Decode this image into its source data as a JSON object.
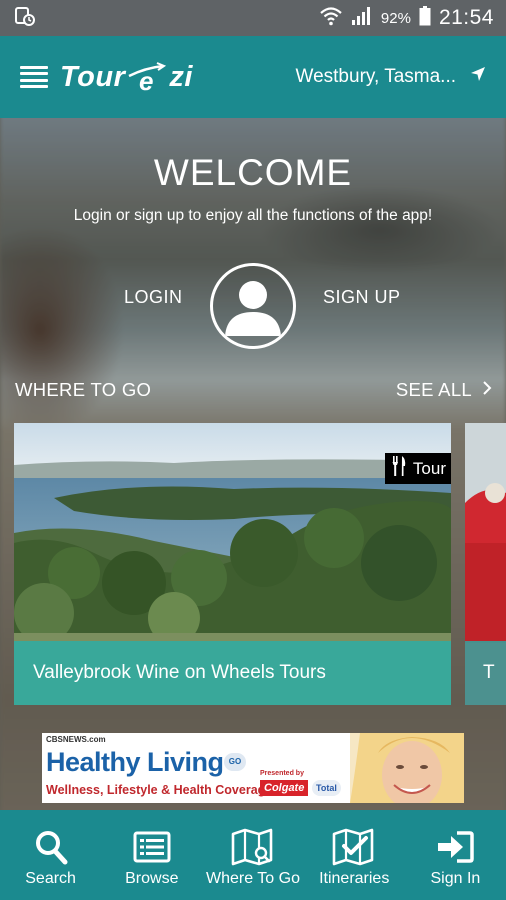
{
  "status_bar": {
    "battery": "92%",
    "time": "21:54",
    "icons": [
      "screenshot-icon",
      "wifi-icon",
      "signal-icon",
      "battery-icon"
    ]
  },
  "header": {
    "logo_left": "Tour",
    "logo_right": "zi",
    "location": "Westbury, Tasma...",
    "icons": [
      "menu-icon",
      "location-arrow-icon"
    ]
  },
  "welcome": {
    "title": "WELCOME",
    "subtitle": "Login or sign up to enjoy all the functions of the app!",
    "login": "LOGIN",
    "signup": "SIGN UP"
  },
  "where_to_go": {
    "title": "WHERE TO GO",
    "see_all": "SEE ALL",
    "cards": [
      {
        "title": "Valleybrook Wine on Wheels Tours",
        "badge": "Tour",
        "badge_icon": "cutlery-icon"
      },
      {
        "title": "T"
      }
    ]
  },
  "ad": {
    "source": "CBSNEWS.com",
    "title": "Healthy Living",
    "tag": "GO",
    "strapline": "Wellness, Lifestyle & Health Coverage",
    "presented_by": "Presented by",
    "brand": "Colgate",
    "brand2": "Total"
  },
  "bottom_nav": [
    {
      "label": "Search",
      "icon": "search-icon"
    },
    {
      "label": "Browse",
      "icon": "browse-icon"
    },
    {
      "label": "Where To Go",
      "icon": "map-icon"
    },
    {
      "label": "Itineraries",
      "icon": "itinerary-map-icon"
    },
    {
      "label": "Sign In",
      "icon": "sign-in-icon"
    }
  ],
  "colors": {
    "primary": "#1b8a8f",
    "caption": "#26b0aa",
    "status_bar": "#5f6366"
  }
}
